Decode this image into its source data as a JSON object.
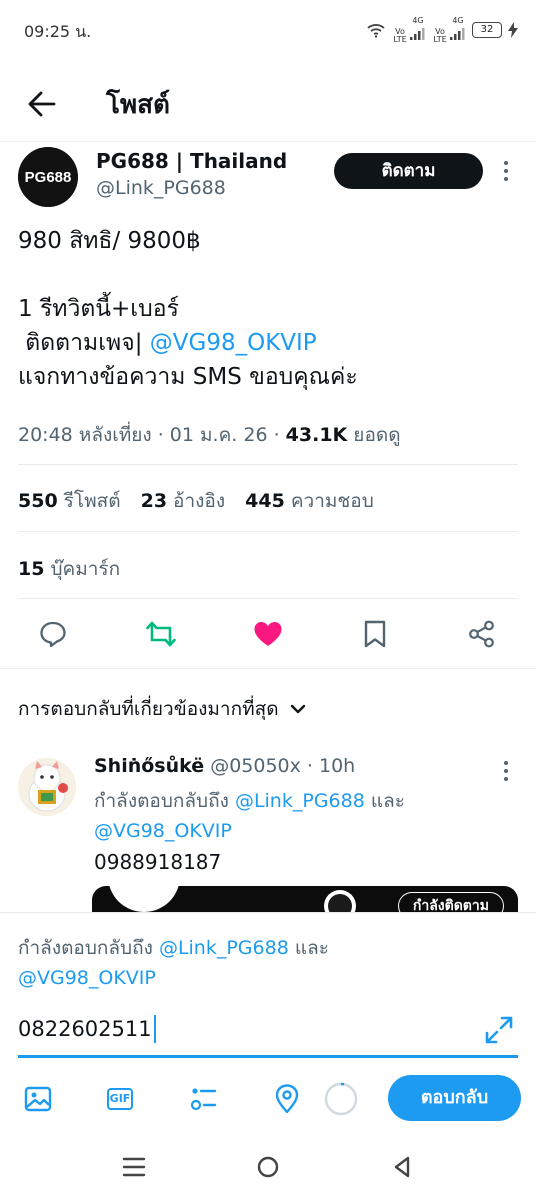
{
  "status_bar": {
    "time": "09:25 น.",
    "sim1": "Vo LTE",
    "sim1_net": "4G",
    "sim2": "Vo LTE",
    "sim2_net": "4G",
    "battery": "32"
  },
  "header": {
    "title": "โพสต์"
  },
  "author": {
    "name": "PG688 | Thailand",
    "handle": "@Link_PG688",
    "avatar_text": "PG688",
    "follow_label": "ติดตาม"
  },
  "tweet": {
    "line1": "980 สิทธิ/ 9800฿",
    "line2": "1 รีทวิตนี้+เบอร์",
    "line3_prefix": " ติดตามเพจ| ",
    "line3_mention": "@VG98_OKVIP",
    "line4": "แจกทางข้อความ SMS ขอบคุณค่ะ",
    "meta_time": "20:48 หลังเที่ยง · 01 ม.ค. 26 · ",
    "meta_views": "43.1K",
    "meta_views_label": " ยอดดู"
  },
  "stats": {
    "reposts": "550",
    "reposts_label": "รีโพสต์",
    "quotes": "23",
    "quotes_label": "อ้างอิง",
    "likes": "445",
    "likes_label": "ความชอบ",
    "bookmarks": "15",
    "bookmarks_label": "บุ๊คมาร์ก"
  },
  "sort": {
    "label": "การตอบกลับที่เกี่ยวข้องมากที่สุด"
  },
  "reply": {
    "name": "Shiṅősůkë",
    "handle_time": " @05050x · 10h",
    "replying_prefix": "กำลังตอบกลับถึง ",
    "mention1": "@Link_PG688",
    "and": " และ ",
    "mention2": "@VG98_OKVIP",
    "text": "0988918187",
    "media_button": "กำลังติดตาม"
  },
  "composer": {
    "replying_prefix": "กำลังตอบกลับถึง ",
    "mention1": "@Link_PG688",
    "and": " และ",
    "mention2": "@VG98_OKVIP",
    "input_value": "0822602511",
    "gif_label": "GIF",
    "reply_button": "ตอบกลับ"
  },
  "colors": {
    "accent": "#1d9bf0",
    "like": "#f91880",
    "repost": "#00ba7c",
    "text": "#0f1419",
    "muted": "#536471"
  }
}
